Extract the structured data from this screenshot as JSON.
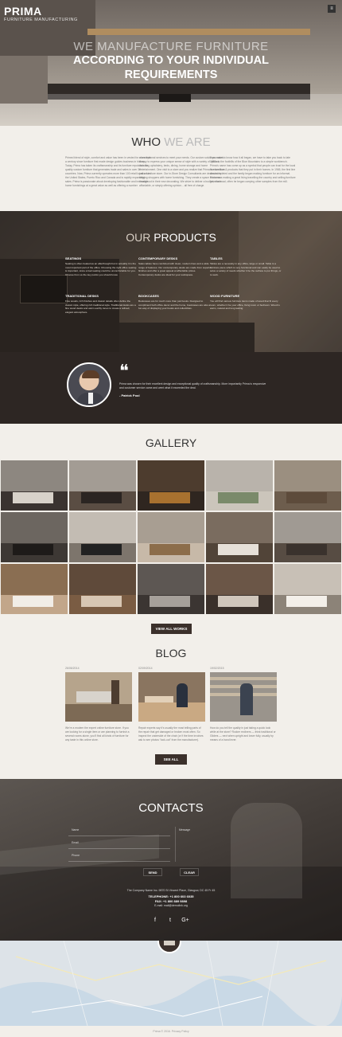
{
  "brand": {
    "name": "PRIMA",
    "tagline": "FURNITURE MANUFACTURING",
    "menu_icon": "≡"
  },
  "hero": {
    "line1": "WE MANUFACTURE FURNITURE",
    "line2": "ACCORDING TO YOUR INDIVIDUAL",
    "line3": "REQUIREMENTS"
  },
  "who": {
    "title_strong": "WHO",
    "title_light": "WE ARE",
    "col1": "Primed blend of style, comfort and value has been in vested for more than a century since furniture first made design guides business in history. Today, Prima has taken its craftsmanship and its furniture reputation for quality custom furniture that generates trade and sales in over 30 countries. Now, Prima currently operates more than 100 retail locations in the United States, Puerto Rico and Canada and is rapidly expanding sales. Prima is passionate about developing fashionable and innovative home furnishings at a great value as well as offering a number",
    "col2": "of exceptional services to meet your needs. Our custom solutions makes it easy to express your unique sense of style with a variety of options, including upholstery, beds, dining, home storage and home entertainment. One visit to a store and you realize that Prima is more than just a furniture store. Our in-Store Design Consultants are dedicated to helping shoppers with home furnishing. They create a space customer throughout in their new decorating. We strive to deliver a budget, made affordable, or simply offering opinion... all free of charge.",
    "col3": "If you want to know how it all began, we have to take you back to late 1960s in the foothills of the Blue Mountains to a simple workbench. Prima’s name has come up as a symbol that people can trust for the local fine furniture & products that they put in their homes. In 1965, the first line was completed and the family began making furniture for an informal. Prima was making a great living travelling the country and selling furniture from the road, often he began carrying other samples from the mill."
  },
  "products": {
    "title_light": "OUR",
    "title_strong": "PRODUCTS",
    "items": [
      {
        "name": "SEATINGS",
        "text": "Seating is often treated as an afterthought but in actuality it is the most important part of the office. Choosing the right office seating is important, since a bad seating could be uncomfortable for you. Choose from us the key points you should know."
      },
      {
        "name": "CONTEMPORARY DESKS",
        "text": "Sales tables have combined with clean, modern lines and a wide range of features. Our contemporary desks are made from superior finishes and offer a great appeal at affordable prices. Contemporary desks are ideal for your workspace."
      },
      {
        "name": "TABLES",
        "text": "Tables are a necessity in any office, large or small. Table is a furniture piece which is very functional and can easily be used to solve a variety of needs whether it be the surface to put things, or to work."
      },
      {
        "name": "TRADITIONAL DESKS",
        "text": "Fine woods, rich finishes and classic details often define the classic style, offering rich traditional style. Traditional desks are a fine wood desks and warm earthy tones to create a refined, elegant atmosphere."
      },
      {
        "name": "BOOKCASES",
        "text": "Bookcases are for much more than just books. Designed to compliment both office decor and the home, bookcases are also a fun way of displaying your books and collectibles."
      },
      {
        "name": "WOOD FURNITURE",
        "text": "You will find various furniture items made of wood that fit every room, whether it be your office, living room or bedroom. Wood is warm, natural and long lasting."
      }
    ]
  },
  "testimonial": {
    "quote_icon": "❝",
    "text": "Prima was chosen for their excellent design and exceptional quality of craftsmanship. More importantly Prima is responsive and customer service came and went what it exceeded the deal.",
    "author": "- Patrick Pool"
  },
  "gallery": {
    "title": "GALLERY",
    "button": "VIEW ALL WORKS",
    "tiles": [
      {
        "bg": "#8d8780",
        "floor": "#3a3330",
        "furn": "#d8d2ca"
      },
      {
        "bg": "#a39c94",
        "floor": "#5a4d43",
        "furn": "#2b2522"
      },
      {
        "bg": "#4d3c2e",
        "floor": "#2f2620",
        "furn": "#a8712f"
      },
      {
        "bg": "#b9b3ab",
        "floor": "#cbc5bb",
        "furn": "#7a8a6a"
      },
      {
        "bg": "#9b8f80",
        "floor": "#6d5d4d",
        "furn": "#5d4b3b"
      },
      {
        "bg": "#6c6660",
        "floor": "#3d3834",
        "furn": "#1e1b19"
      },
      {
        "bg": "#c3bcb3",
        "floor": "#7d756c",
        "furn": "#222"
      },
      {
        "bg": "#a89e92",
        "floor": "#c7b9a8",
        "furn": "#8c6d4a"
      },
      {
        "bg": "#7a6c5f",
        "floor": "#514438",
        "furn": "#e6e0d8"
      },
      {
        "bg": "#a09a93",
        "floor": "#574c43",
        "furn": "#3a322d"
      },
      {
        "bg": "#8a6e52",
        "floor": "#c2a68a",
        "furn": "#f1ede7"
      },
      {
        "bg": "#5f4a3a",
        "floor": "#7a5c43",
        "furn": "#d7c6b3"
      },
      {
        "bg": "#5d5753",
        "floor": "#3b3532",
        "furn": "#a6a09a"
      },
      {
        "bg": "#6b5647",
        "floor": "#3a302a",
        "furn": "#d0c6bb"
      },
      {
        "bg": "#c8c0b6",
        "floor": "#8c8378",
        "furn": "#f3efe9"
      }
    ]
  },
  "blog": {
    "title": "BLOG",
    "button": "SEE ALL",
    "posts": [
      {
        "date": "26/06/2014",
        "text": "We’re a modern the expert online furniture store. If you are looking for a single item or are planning to furnish a several rooms alone, you’ll find all kinds of furniture for any taste in this online store."
      },
      {
        "date": "02/09/2014",
        "text": "Repair experts say it’s usually the most telling parts of the repair that get damaged or broken most often. So inspect the underside of the chair (or if the time involves ask to see photos “look-out” from the manufacturer)."
      },
      {
        "date": "19/02/2015",
        "text": "How do you tell the quality in just taking a quick look while at the store? Rocker recliners — think traditional or Gliders — next when upright and lower fully, usually by means of a hand lever."
      }
    ]
  },
  "contacts": {
    "title": "CONTACTS",
    "name_placeholder": "Name",
    "email_placeholder": "Email",
    "phone_placeholder": "Phone",
    "message_placeholder": "Message",
    "send": "SEND",
    "clear": "CLEAR",
    "address": "The Company Name Inc. 9870 St Vincent Place, Glasgow, DC 45 Fr 45",
    "telephone": "TELEPHONE: +1 800 603 6035",
    "fax": "FAX: +1 800 889 9898",
    "email": "E-mail: mail@demolink.org",
    "social": [
      "f",
      "t",
      "G+"
    ]
  },
  "footer": {
    "text": "Prima © 2016. Privacy Policy"
  },
  "colors": {
    "dark": "#3b302b",
    "light_bg": "#f2efea"
  }
}
